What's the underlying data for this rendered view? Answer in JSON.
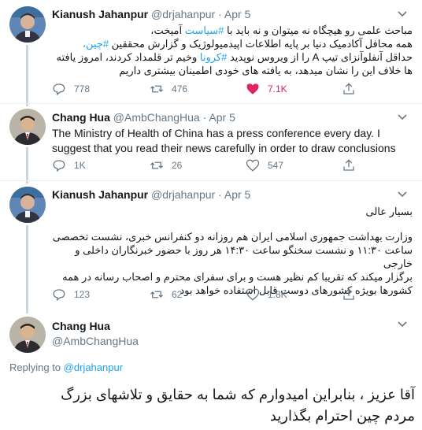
{
  "tweets": [
    {
      "name": "Kianush Jahanpur",
      "handle": "@drjahanpur",
      "dot": "·",
      "date": "Apr 5",
      "lines": [
        {
          "pre": "مباحث علمی رو هیچگاه نه میتوان و نه باید با ",
          "tag": "#سیاست",
          "post": " آمیخت،"
        },
        {
          "pre": "همه محافل آکادمیک دنیا بر پایه اطلاعات اپیدمیولوژیک و گزارش محققین ",
          "tag": "#چین،",
          "post": ""
        },
        {
          "pre": "حداقل آنفلوآنزای تیپ A را از ویروس نوپدید ",
          "tag": "#کرونا",
          "post": " وخیم تر قلمداد کردند، امروز یافته"
        },
        {
          "pre": "ها خلاف این را نشان میدهد، به یافته های خودی اطمینان بیشتری داریم",
          "tag": "",
          "post": ""
        }
      ],
      "replies": "778",
      "retweets": "476",
      "likes": "7.1K"
    },
    {
      "name": "Chang Hua",
      "handle": "@AmbChangHua",
      "dot": "·",
      "date": "Apr 5",
      "text": "The Ministry of Health of China has a press conference every day. I suggest that you read their news carefully in order to draw conclusions",
      "replies": "1K",
      "retweets": "26",
      "likes": "547"
    },
    {
      "name": "Kianush Jahanpur",
      "handle": "@drjahanpur",
      "dot": "·",
      "date": "Apr 5",
      "greeting": "بسیار عالی",
      "lines": [
        "وزارت بهداشت جمهوری اسلامی ایران هم روزانه دو کنفرانس خبری، نشست تخصصی",
        "ساعت ۱۱:۳۰ و نشست سخنگو ساعت ۱۴:۳۰ هر روز با حضور خبرنگاران داخلی و خارجی",
        "برگزار میکند که تقریبا کم نظیر هست و برای سفرای محترم و اصحاب رسانه در همه",
        "کشورها بویژه کشورهای دوست قابل استفاده خواهد بود"
      ],
      "replies": "123",
      "retweets": "62",
      "likes": "1.8K"
    }
  ],
  "main_tweet": {
    "name": "Chang Hua",
    "handle": "@AmbChangHua",
    "replying_label": "Replying to",
    "replying_to": "@drjahanpur",
    "lines": [
      "آقا عزیز ، بنابراین امیدوارم که شما به حقایق و تلاشهای بزرگ",
      "مردم چین احترام بگذارید"
    ]
  },
  "colors": {
    "link": "#1da1f2",
    "like_active": "#e0245e",
    "muted": "#657786"
  }
}
